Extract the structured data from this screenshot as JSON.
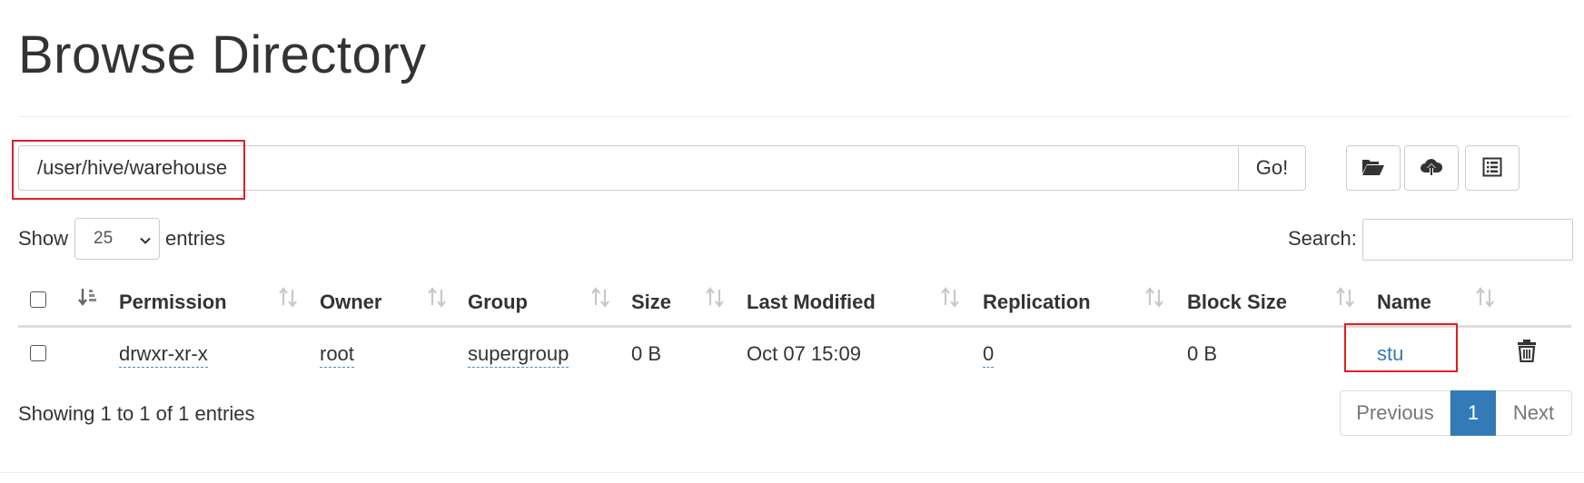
{
  "page": {
    "title": "Browse Directory"
  },
  "path": {
    "value": "/user/hive/warehouse",
    "go_label": "Go!"
  },
  "toolbar": {
    "icons": [
      "folder-open-icon",
      "cloud-upload-icon",
      "list-alt-icon"
    ]
  },
  "length": {
    "show_label": "Show",
    "value": "25",
    "entries_label": "entries"
  },
  "search": {
    "label": "Search:",
    "value": ""
  },
  "table": {
    "columns": [
      "Permission",
      "Owner",
      "Group",
      "Size",
      "Last Modified",
      "Replication",
      "Block Size",
      "Name"
    ],
    "rows": [
      {
        "permission": "drwxr-xr-x",
        "owner": "root",
        "group": "supergroup",
        "size": "0 B",
        "last_modified": "Oct 07 15:09",
        "replication": "0",
        "block_size": "0 B",
        "name": "stu"
      }
    ]
  },
  "info": {
    "text": "Showing 1 to 1 of 1 entries"
  },
  "pagination": {
    "previous": "Previous",
    "current": "1",
    "next": "Next"
  },
  "colors": {
    "link": "#337ab7",
    "active_page": "#337ab7",
    "highlight": "#e01e26"
  }
}
